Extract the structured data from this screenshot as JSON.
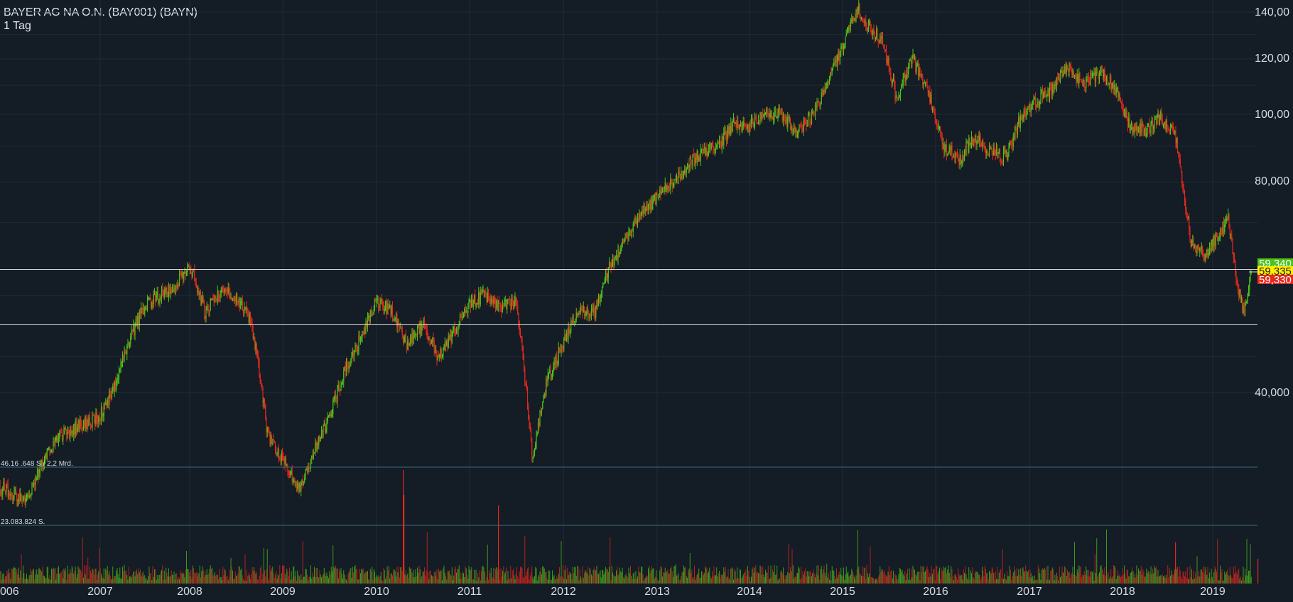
{
  "header": {
    "title": "BAYER AG NA O.N. (BAY001) (BAYN)",
    "interval": "1 Tag"
  },
  "colors": {
    "background": "#141c25",
    "grid": "#1f2b37",
    "up": "#4cc21b",
    "down": "#e5281e",
    "text": "#d8dde3",
    "hline": "#d9d9d9",
    "volume_divider": "#3b6d80"
  },
  "chart_data": [
    {
      "type": "line",
      "subtype": "candlestick",
      "scale": "log",
      "series": [
        {
          "x": [
            "2006-01-01",
            "2006-03",
            "2006-05",
            "2006-07",
            "2006-09",
            "2006-11",
            "2007-01",
            "2007-03",
            "2007-05",
            "2007-07",
            "2007-09",
            "2007-11",
            "2008-01",
            "2008-03",
            "2008-05",
            "2008-07",
            "2008-09",
            "2008-11",
            "2009-01",
            "2009-03",
            "2009-05",
            "2009-07",
            "2009-09",
            "2009-11",
            "2010-01",
            "2010-03",
            "2010-05",
            "2010-07",
            "2010-09",
            "2010-11",
            "2011-01",
            "2011-03",
            "2011-05",
            "2011-07",
            "2011-08-15",
            "2011-09",
            "2011-11",
            "2012-01",
            "2012-03",
            "2012-05",
            "2012-07",
            "2012-09",
            "2012-11",
            "2013-01",
            "2013-03",
            "2013-05",
            "2013-07",
            "2013-09",
            "2013-11",
            "2014-01",
            "2014-03",
            "2014-05",
            "2014-07",
            "2014-09",
            "2014-11",
            "2015-01",
            "2015-03",
            "2015-04",
            "2015-06",
            "2015-08",
            "2015-10",
            "2015-12",
            "2016-02",
            "2016-04",
            "2016-06",
            "2016-08",
            "2016-10",
            "2016-12",
            "2017-02",
            "2017-04",
            "2017-06",
            "2017-08",
            "2017-10",
            "2017-12",
            "2018-02",
            "2018-04",
            "2018-06",
            "2018-08",
            "2018-10",
            "2018-12",
            "2019-02",
            "2019-03",
            "2019-04",
            "2019-05",
            "2019-06"
          ],
          "y": [
            30,
            29,
            28,
            32,
            35,
            36,
            37,
            41,
            48,
            53,
            55,
            57,
            61,
            52,
            56,
            55,
            50,
            35,
            32,
            29,
            33,
            37,
            43,
            48,
            54,
            52,
            47,
            50,
            45,
            49,
            54,
            55,
            53,
            54,
            38,
            32,
            42,
            47,
            53,
            52,
            61,
            66,
            72,
            76,
            80,
            85,
            88,
            90,
            97,
            96,
            101,
            100,
            94,
            99,
            110,
            125,
            142,
            135,
            128,
            105,
            120,
            108,
            90,
            86,
            93,
            88,
            87,
            99,
            105,
            109,
            117,
            110,
            115,
            110,
            96,
            95,
            99,
            94,
            66,
            63,
            68,
            71,
            58,
            52,
            59.33
          ]
        }
      ],
      "title": "BAYER AG NA O.N. (BAY001) (BAYN)",
      "x_ticks": [
        "006",
        "2007",
        "2008",
        "2009",
        "2010",
        "2011",
        "2012",
        "2013",
        "2014",
        "2015",
        "2016",
        "2017",
        "2018",
        "2019"
      ],
      "y_ticks": [
        "140,00",
        "120,00",
        "100,00",
        "80,000",
        "40,000"
      ],
      "ylim": [
        29,
        145
      ],
      "horizontal_lines": [
        60,
        50
      ],
      "price_labels": [
        {
          "text": "59,340",
          "color": "#4cc21b"
        },
        {
          "text": "59,335",
          "color": "#ffee00"
        },
        {
          "text": "59,330",
          "color": "#e5281e"
        }
      ],
      "grid": true
    },
    {
      "type": "bar",
      "title": "Volume",
      "labels": [
        "46.16 .648 S  / 2,2 Mrd.",
        "23.083.824 S."
      ],
      "values": [
        46167648,
        23083824
      ]
    }
  ]
}
